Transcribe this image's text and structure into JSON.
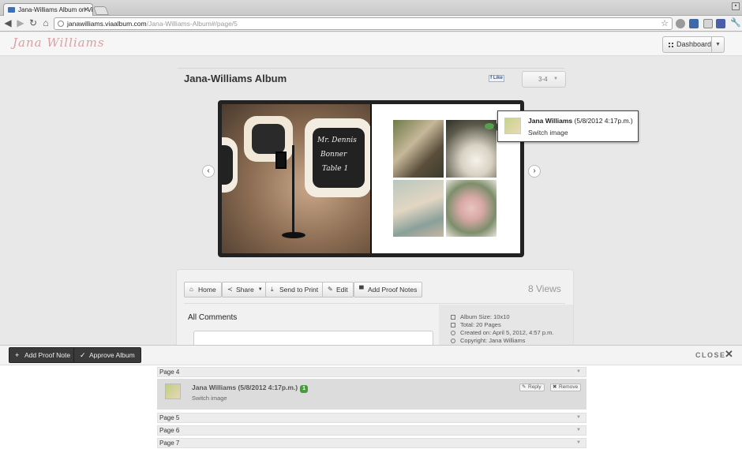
{
  "browser": {
    "tab_title": "Jana-Williams Album on Vial",
    "url_domain": "janawilliams.viaalbum.com",
    "url_path": "/Jana-Williams-Album#/page/5"
  },
  "site": {
    "logo_text": "Jana Williams",
    "dashboard_label": "Dashboard"
  },
  "album": {
    "title": "Jana-Williams Album",
    "like_label": "Like",
    "page_selector": "3-4",
    "card_texts": [
      "Mr. Dennis",
      "Bonner",
      "Table 1"
    ]
  },
  "tooltip": {
    "name": "Jana Williams",
    "date": "(5/8/2012 4:17p.m.)",
    "text": "Switch image"
  },
  "toolbar": {
    "buttons": [
      "Home",
      "Share",
      "Send to Print",
      "Edit",
      "Add Proof Notes"
    ],
    "views": "8 Views"
  },
  "comments": {
    "heading": "All Comments"
  },
  "info": [
    "Album Size: 10x10",
    "Total: 20 Pages",
    "Created on: April 5, 2012, 4:57 p.m.",
    "Copyright: Jana Williams"
  ],
  "proofbar": {
    "add_label": "Add Proof Note",
    "approve_label": "Approve Album",
    "close_label": "CLOSE"
  },
  "proof_pages": {
    "page4": "Page 4",
    "page5": "Page 5",
    "page6": "Page 6",
    "page7": "Page 7"
  },
  "proof_comment": {
    "name": "Jana Williams",
    "date": "(5/8/2012 4:17p.m.)",
    "badge": "1",
    "text": "Switch image",
    "reply_label": "Reply",
    "remove_label": "Remove"
  },
  "colors": {
    "badge_green": "#4b9a43",
    "dark_button": "#3a3a3a",
    "logo_pink": "#d9a0a0"
  }
}
